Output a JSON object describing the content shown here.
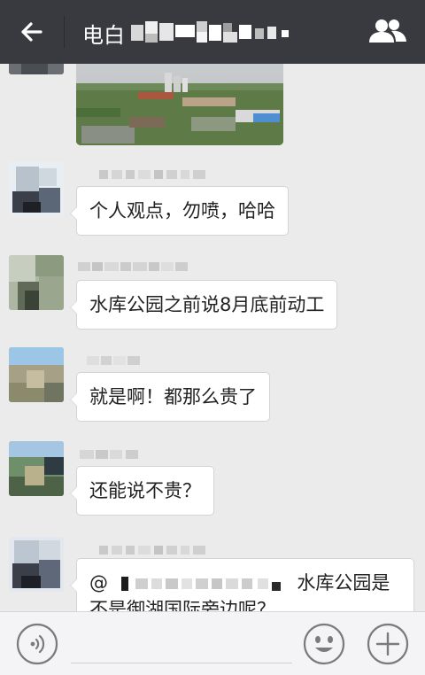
{
  "header": {
    "title": "电白",
    "back_icon": "back-arrow-icon",
    "group_icon": "group-members-icon",
    "bg_color": "#393a3f"
  },
  "messages": [
    {
      "type": "image"
    },
    {
      "type": "text",
      "text": "个人观点，勿喷，哈哈"
    },
    {
      "type": "text",
      "text": "水库公园之前说8月底前动工"
    },
    {
      "type": "text",
      "text": "就是啊！都那么贵了"
    },
    {
      "type": "text",
      "text": "还能说不贵？"
    },
    {
      "type": "text",
      "mention_prefix": "@",
      "text": "水库公园是",
      "text_line2": "不是御湖国际旁边呢？"
    }
  ],
  "footer": {
    "voice_icon": "voice-icon",
    "emoji_icon": "emoji-icon",
    "plus_icon": "plus-icon"
  }
}
